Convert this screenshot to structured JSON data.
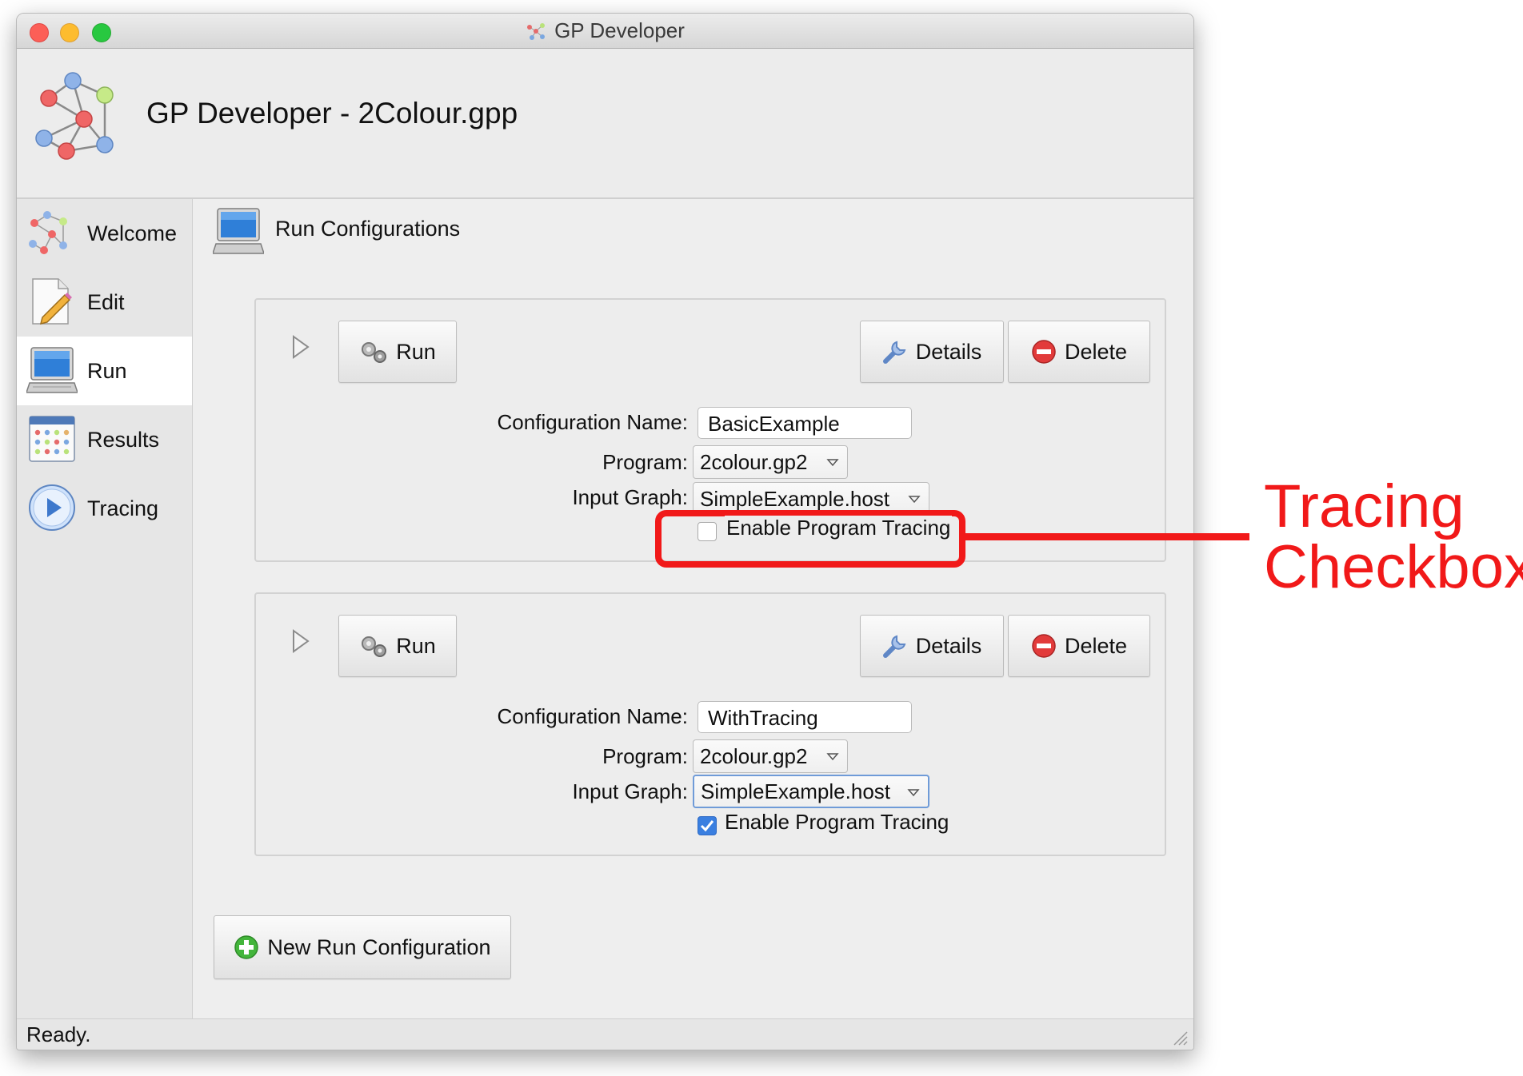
{
  "window": {
    "title": "GP Developer"
  },
  "header": {
    "title": "GP Developer - 2Colour.gpp"
  },
  "sidebar": {
    "items": [
      {
        "label": "Welcome",
        "icon": "graph-icon"
      },
      {
        "label": "Edit",
        "icon": "edit-icon"
      },
      {
        "label": "Run",
        "icon": "computer-icon",
        "active": true
      },
      {
        "label": "Results",
        "icon": "results-icon"
      },
      {
        "label": "Tracing",
        "icon": "play-icon"
      }
    ]
  },
  "main": {
    "title": "Run Configurations",
    "labels": {
      "config_name": "Configuration Name:",
      "program": "Program:",
      "input_graph": "Input Graph:",
      "enable_tracing": "Enable Program Tracing"
    },
    "buttons": {
      "run": "Run",
      "details": "Details",
      "delete": "Delete"
    },
    "configs": [
      {
        "name": "BasicExample",
        "program": "2colour.gp2",
        "input_graph": "SimpleExample.host",
        "tracing": false
      },
      {
        "name": "WithTracing",
        "program": "2colour.gp2",
        "input_graph": "SimpleExample.host",
        "tracing": true
      }
    ],
    "new_config_label": "New Run Configuration"
  },
  "status": {
    "text": "Ready."
  },
  "annotation": {
    "line1": "Tracing",
    "line2": "Checkbox",
    "color": "#f11919"
  },
  "colors": {
    "accent": "#3a7fe0",
    "delete": "#e23b3b",
    "add": "#43b53b"
  }
}
